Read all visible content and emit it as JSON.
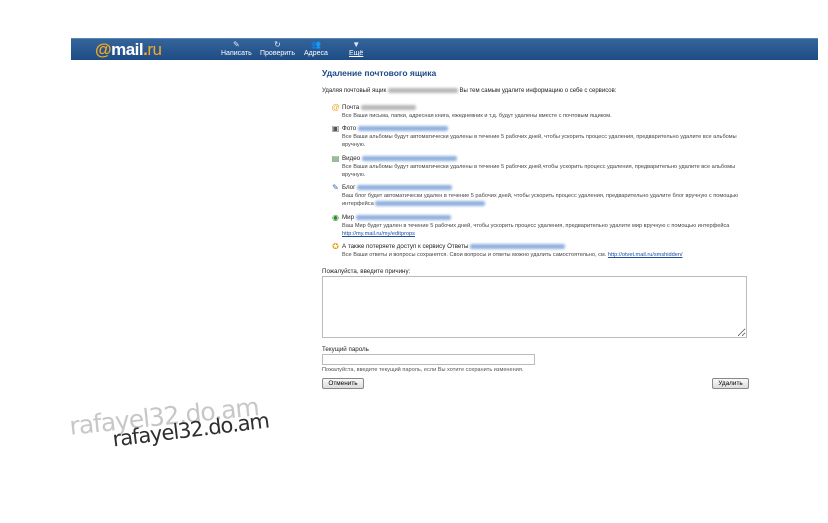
{
  "header": {
    "logo": {
      "at": "@",
      "mail": "mail",
      "dot": ".",
      "ru": "ru"
    },
    "nav": [
      {
        "label": "Написать",
        "icon": "pencil-icon"
      },
      {
        "label": "Проверить",
        "icon": "refresh-icon"
      },
      {
        "label": "Адреса",
        "icon": "contacts-icon"
      },
      {
        "label": "Ещё",
        "icon": "chevron-down-icon"
      }
    ]
  },
  "page": {
    "title": "Удаление почтового ящика",
    "intro_prefix": "Удаляя почтовый ящик",
    "intro_suffix": "Вы тем самым удалите информацию о себе с сервисов:"
  },
  "services": [
    {
      "name": "Почта",
      "icon": "mail-icon",
      "desc": "Все Ваши письма, папки, адресная книга, ежедневник и т.д. будут удалены вместе с почтовым ящиком."
    },
    {
      "name": "Фото",
      "icon": "camera-icon",
      "desc": "Все Ваши альбомы будут автоматически удалены в течение 5 рабочих дней, чтобы ускорить процесс удаления, предварительно удалите все альбомы вручную."
    },
    {
      "name": "Видео",
      "icon": "video-icon",
      "desc": "Все Ваши альбомы будут автоматически удалены в течение 5 рабочих дней,чтобы ускорить процесс удаления, предварительно удалите все альбомы вручную."
    },
    {
      "name": "Блог",
      "icon": "blog-icon",
      "desc": "Ваш блог будет автоматически удален в течение 5 рабочих дней, чтобы ускорить процесс удаления, предварительно удалите блог вручную с помощью интерфейса"
    },
    {
      "name": "Мир",
      "icon": "world-icon",
      "desc": "Ваш Мир будет удален в течение 5 рабочих дней, чтобы ускорить процесс удаления, предварительно удалите мир вручную с помощью интерфейса",
      "link": "http://my.mail.ru/my/editprops"
    },
    {
      "name": "А также потеряете доступ к сервису Ответы",
      "icon": "answers-icon",
      "desc": "Все Ваши ответы и вопросы сохранятся. Свои вопросы и ответы можно удалить самостоятельно, см.",
      "link": "http://otvet.mail.ru/smshidden/"
    }
  ],
  "form": {
    "reason_label": "Пожалуйста, введите причину:",
    "password_label": "Текущий пароль",
    "password_hint": "Пожалуйста, введите текущий пароль, если Вы хотите сохранить изменения.",
    "cancel_label": "Отменить",
    "delete_label": "Удалить"
  },
  "watermark": {
    "line1": "rafayel32.do.am",
    "line2": "rafayel32.do.am"
  },
  "colors": {
    "topbar": "#2a5a94",
    "title": "#1c4a86",
    "link": "#1a4fa3",
    "logo_accent": "#f7a91f"
  }
}
